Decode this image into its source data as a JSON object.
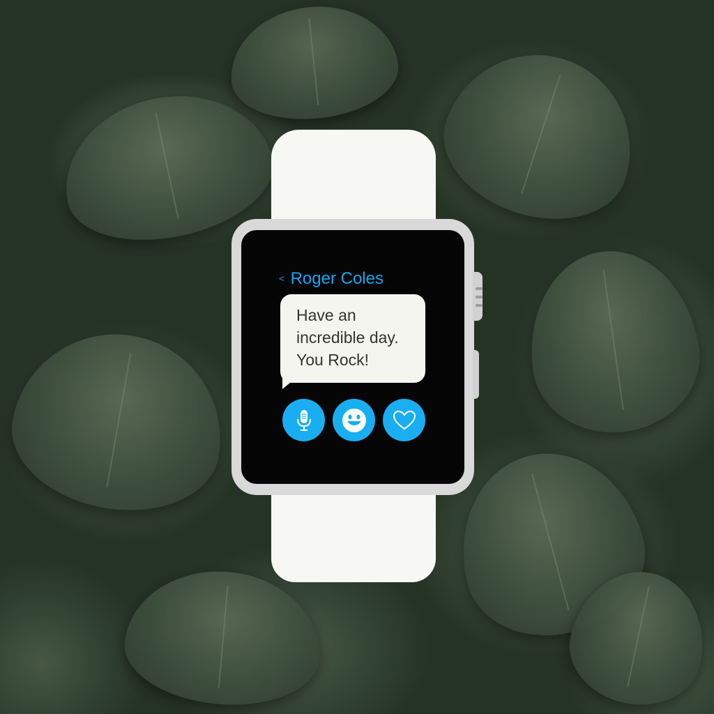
{
  "contact": {
    "back_icon": "chevron-left-icon",
    "name": "Roger Coles"
  },
  "message": {
    "lines": [
      "Have an",
      "incredible day.",
      "You Rock!"
    ]
  },
  "actions": [
    {
      "icon": "microphone-icon"
    },
    {
      "icon": "smiley-face-icon"
    },
    {
      "icon": "heart-icon"
    }
  ],
  "colors": {
    "accent": "#19aef2",
    "screen": "#050505",
    "bubble": "#f5f5f0",
    "band": "#f7f7f3",
    "case": "#d8d9d8",
    "background": "#2f3f2f"
  }
}
